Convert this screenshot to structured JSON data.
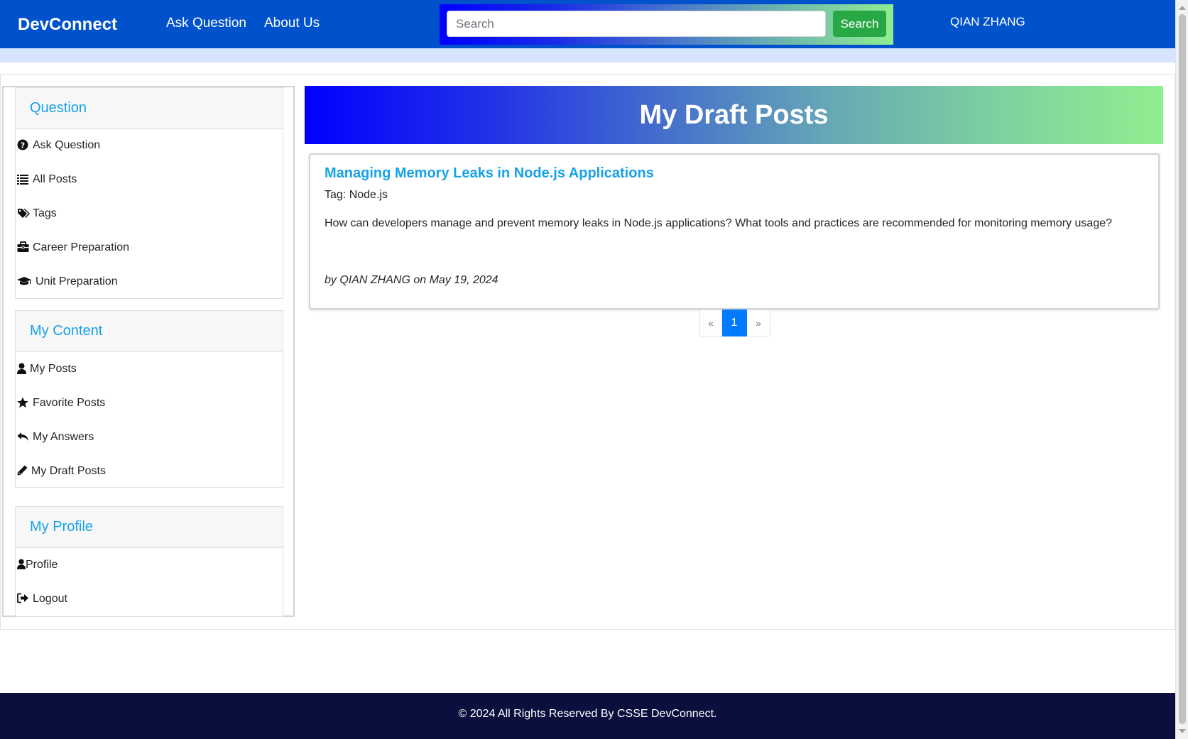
{
  "navbar": {
    "brand": "DevConnect",
    "links": [
      "Ask Question",
      "About Us"
    ],
    "search_placeholder": "Search",
    "search_button": "Search",
    "user": "QIAN ZHANG"
  },
  "sidebar": {
    "sections": [
      {
        "title": "Question",
        "items": [
          {
            "label": "Ask Question",
            "icon": "question-circle-icon"
          },
          {
            "label": "All Posts",
            "icon": "list-icon"
          },
          {
            "label": "Tags",
            "icon": "tags-icon"
          },
          {
            "label": "Career Preparation",
            "icon": "briefcase-icon"
          },
          {
            "label": "Unit Preparation",
            "icon": "graduation-cap-icon"
          }
        ]
      },
      {
        "title": "My Content",
        "items": [
          {
            "label": "My Posts",
            "icon": "user-icon"
          },
          {
            "label": "Favorite Posts",
            "icon": "star-icon"
          },
          {
            "label": "My Answers",
            "icon": "reply-icon"
          },
          {
            "label": "My Draft Posts",
            "icon": "pencil-icon"
          }
        ]
      },
      {
        "title": "My Profile",
        "items": [
          {
            "label": "Profile",
            "icon": "user-icon"
          },
          {
            "label": "Logout",
            "icon": "sign-out-icon"
          }
        ]
      }
    ]
  },
  "main": {
    "heading": "My Draft Posts",
    "posts": [
      {
        "title": "Managing Memory Leaks in Node.js Applications",
        "tag": "Tag: Node.js",
        "body": "How can developers manage and prevent memory leaks in Node.js applications? What tools and practices are recommended for monitoring memory usage?",
        "meta": "by QIAN ZHANG on May 19, 2024"
      }
    ],
    "pagination": {
      "prev": "«",
      "current": "1",
      "next": "»"
    }
  },
  "footer": {
    "text": "© 2024 All Rights Reserved By CSSE DevConnect."
  },
  "colors": {
    "navbar": "#0052cc",
    "accent": "#17a2e8",
    "search_button": "#28a745",
    "page_active": "#007bff",
    "footer": "#0a0f3d"
  }
}
